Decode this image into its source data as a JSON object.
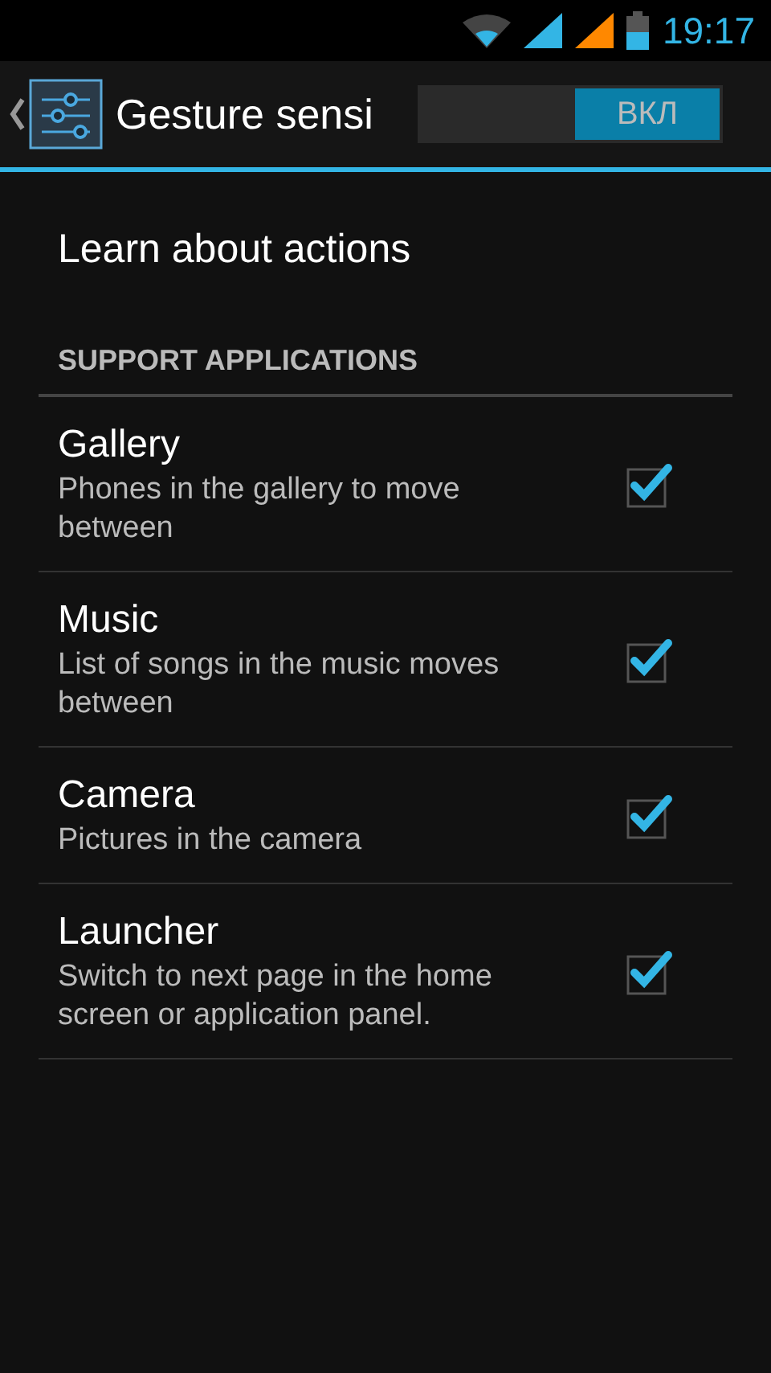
{
  "status_bar": {
    "time": "19:17"
  },
  "action_bar": {
    "title": "Gesture sensi",
    "switch": {
      "label": "ВКЛ",
      "on": true
    }
  },
  "learn": {
    "label": "Learn about actions"
  },
  "section": {
    "title": "SUPPORT APPLICATIONS"
  },
  "items": [
    {
      "title": "Gallery",
      "summary": "Phones in the gallery to move between",
      "checked": true
    },
    {
      "title": "Music",
      "summary": "List of songs in the music moves between",
      "checked": true
    },
    {
      "title": "Camera",
      "summary": "Pictures in the camera",
      "checked": true
    },
    {
      "title": "Launcher",
      "summary": "Switch to next page in the home screen or application panel.",
      "checked": true
    }
  ]
}
